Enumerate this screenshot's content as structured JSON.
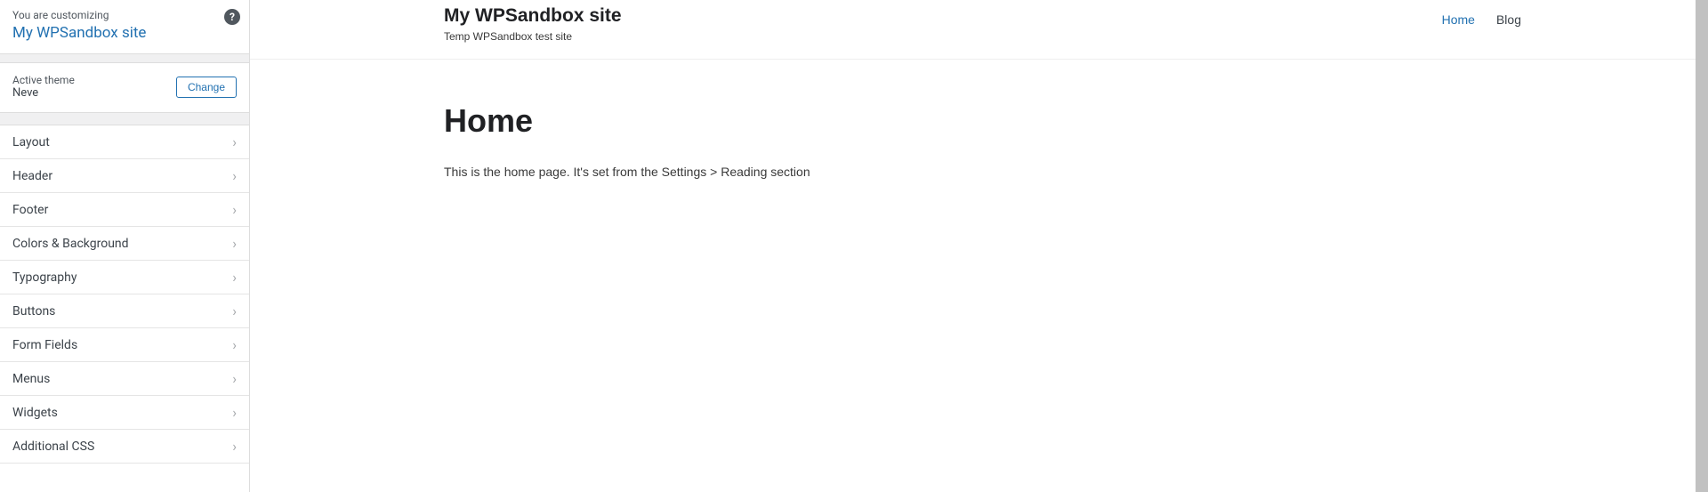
{
  "sidebar": {
    "customizing_label": "You are customizing",
    "site_name": "My WPSandbox site",
    "help_icon_glyph": "?",
    "active_theme_label": "Active theme",
    "theme_name": "Neve",
    "change_button_label": "Change",
    "menu_items": [
      {
        "label": "Layout"
      },
      {
        "label": "Header"
      },
      {
        "label": "Footer"
      },
      {
        "label": "Colors & Background"
      },
      {
        "label": "Typography"
      },
      {
        "label": "Buttons"
      },
      {
        "label": "Form Fields"
      },
      {
        "label": "Menus"
      },
      {
        "label": "Widgets"
      },
      {
        "label": "Additional CSS"
      }
    ]
  },
  "preview": {
    "site_title": "My WPSandbox site",
    "tagline": "Temp WPSandbox test site",
    "nav": [
      {
        "label": "Home",
        "active": true
      },
      {
        "label": "Blog",
        "active": false
      }
    ],
    "page_title": "Home",
    "page_body": "This is the home page. It's set from the Settings > Reading section"
  }
}
